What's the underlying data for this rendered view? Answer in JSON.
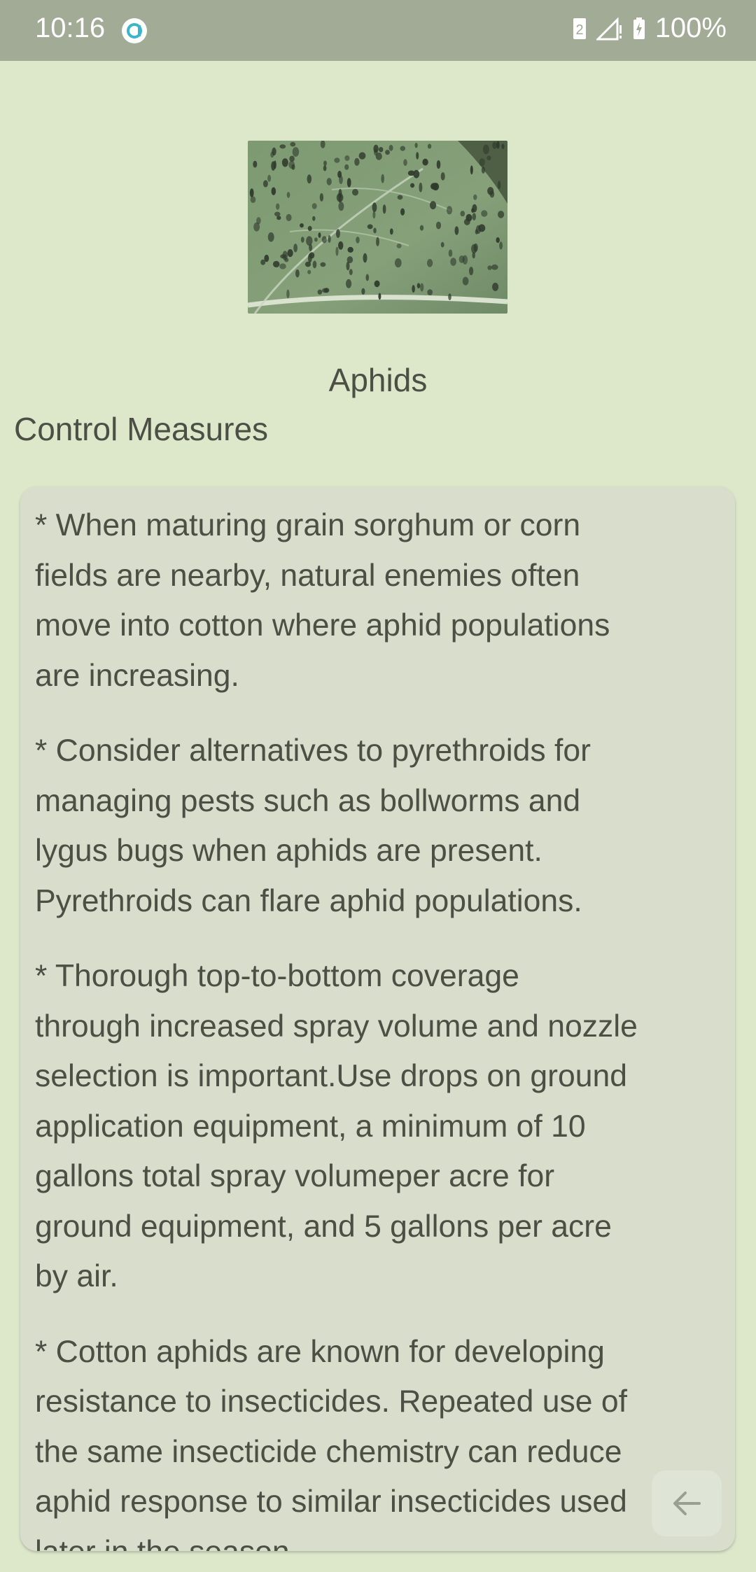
{
  "status_bar": {
    "time": "10:16",
    "sim_slot": "2",
    "battery": "100%",
    "icons": [
      "app-notification-icon",
      "sim-icon",
      "signal-icon",
      "battery-charging-icon"
    ]
  },
  "pest": {
    "name": "Aphids",
    "image_icon": "aphids-on-leaf-photo"
  },
  "section": {
    "title": "Control Measures"
  },
  "measures": [
    "* When maturing grain sorghum or corn\nfields are nearby, natural enemies often\nmove into cotton where aphid populations\nare increasing.",
    "* Consider alternatives to pyrethroids for\nmanaging pests such as bollworms and\nlygus bugs when aphids are present.\nPyrethroids can flare aphid populations.",
    "* Thorough top-to-bottom coverage\nthrough increased spray volume and nozzle\nselection is important.Use drops on ground\napplication equipment, a minimum of 10\ngallons total spray volumeper acre for\nground equipment, and 5 gallons per acre\nby air.",
    "* Cotton aphids are known for developing\nresistance to insecticides. Repeated use of\nthe same insecticide chemistry can reduce\naphid response to similar insecticides used\nlater in the season."
  ],
  "navigation": {
    "back_icon": "arrow-left-icon"
  },
  "colors": {
    "background": "#dde8cb",
    "status_bar": "#a2ab96",
    "card": "#d8ddcc",
    "text": "#4b4f44"
  }
}
